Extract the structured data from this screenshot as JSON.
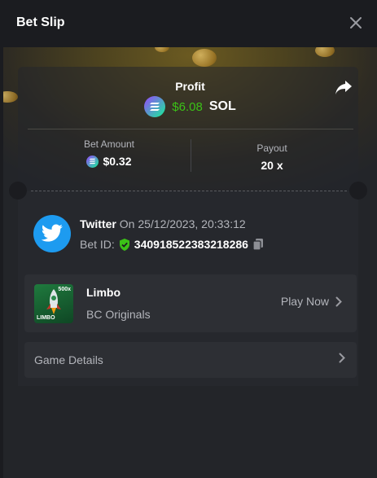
{
  "header": {
    "title": "Bet Slip"
  },
  "profit": {
    "label": "Profit",
    "amount": "$6.08",
    "currency": "SOL"
  },
  "bet": {
    "amount_label": "Bet Amount",
    "amount_value": "$0.32",
    "payout_label": "Payout",
    "payout_value": "20 x"
  },
  "source": {
    "name": "Twitter",
    "date_text": "On 25/12/2023, 20:33:12",
    "bet_id_label": "Bet ID:",
    "bet_id": "340918522383218286"
  },
  "game": {
    "name": "Limbo",
    "provider": "BC Originals",
    "play_label": "Play Now",
    "thumb_text": "LIMBO",
    "thumb_mult": "500x"
  },
  "details": {
    "label": "Game Details"
  },
  "colors": {
    "profit_green": "#3bc117",
    "accent_twitter": "#1d9bf0"
  },
  "icons": [
    "close-icon",
    "solana-icon",
    "share-icon",
    "twitter-icon",
    "verified-shield-icon",
    "copy-icon",
    "chevron-right-icon"
  ]
}
